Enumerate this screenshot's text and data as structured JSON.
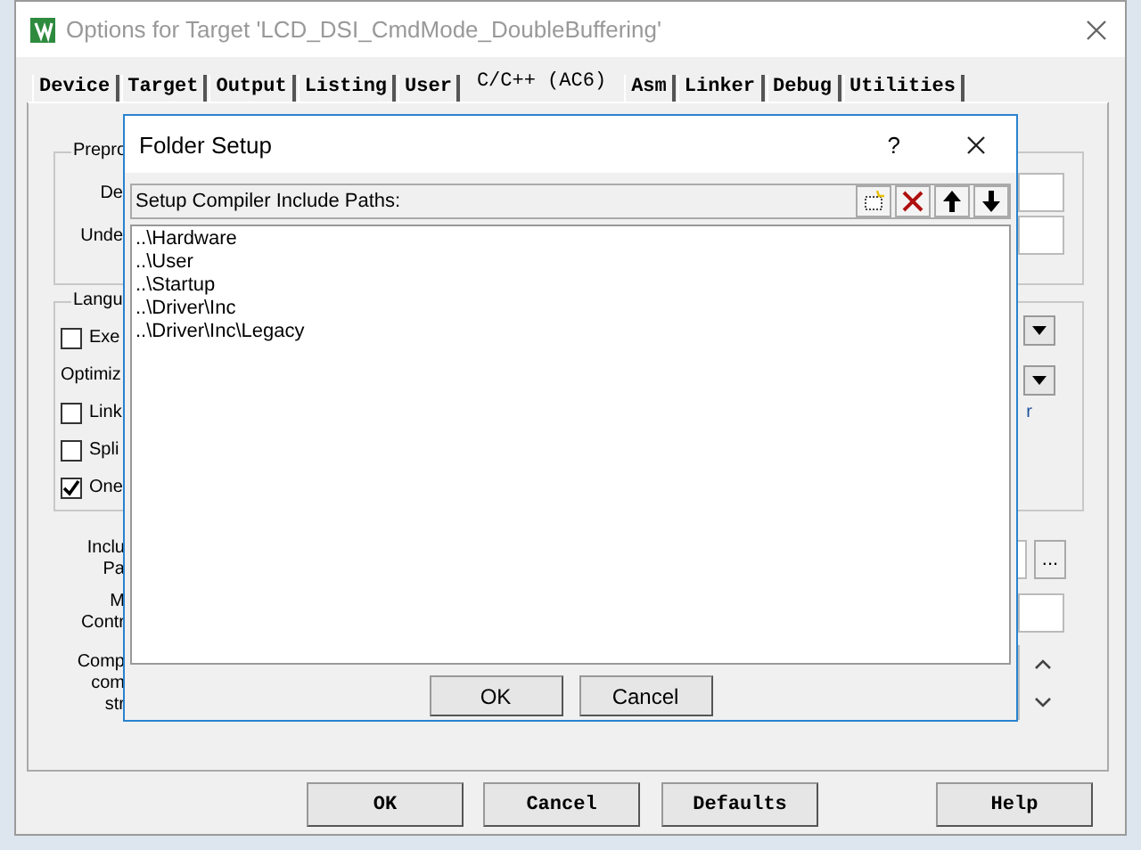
{
  "window": {
    "title": "Options for Target 'LCD_DSI_CmdMode_DoubleBuffering'"
  },
  "tabs": [
    {
      "label": "Device",
      "selected": false
    },
    {
      "label": "Target",
      "selected": false
    },
    {
      "label": "Output",
      "selected": false
    },
    {
      "label": "Listing",
      "selected": false
    },
    {
      "label": "User",
      "selected": false
    },
    {
      "label": "C/C++ (AC6)",
      "selected": true
    },
    {
      "label": "Asm",
      "selected": false
    },
    {
      "label": "Linker",
      "selected": false
    },
    {
      "label": "Debug",
      "selected": false
    },
    {
      "label": "Utilities",
      "selected": false
    }
  ],
  "panel": {
    "preprocessor_group": {
      "legend": "Prepro",
      "labels": [
        "De",
        "Unde"
      ]
    },
    "language_group": {
      "legend": "Langu",
      "rows": [
        {
          "kind": "checkbox",
          "label": "Exe",
          "checked": false
        },
        {
          "kind": "label",
          "label": "Optimiz"
        },
        {
          "kind": "checkbox",
          "label": "Link",
          "checked": false,
          "link_fragment": "r"
        },
        {
          "kind": "checkbox",
          "label": "Spli",
          "checked": false
        },
        {
          "kind": "checkbox",
          "label": "One",
          "checked": true
        }
      ]
    },
    "include_paths": {
      "lines": [
        "Inclu",
        "Pa"
      ],
      "browse": "..."
    },
    "misc_controls": {
      "lines": [
        "M",
        "Contr"
      ]
    },
    "compiler_string": {
      "lines": [
        "Comp",
        "com",
        "str"
      ]
    }
  },
  "folder_dialog": {
    "title": "Folder Setup",
    "help": "?",
    "list_label": "Setup Compiler Include Paths:",
    "paths": [
      "..\\Hardware",
      "..\\User",
      "..\\Startup",
      "..\\Driver\\Inc",
      "..\\Driver\\Inc\\Legacy"
    ],
    "buttons": [
      "OK",
      "Cancel"
    ]
  },
  "buttons": [
    "OK",
    "Cancel",
    "Defaults",
    "Help"
  ]
}
